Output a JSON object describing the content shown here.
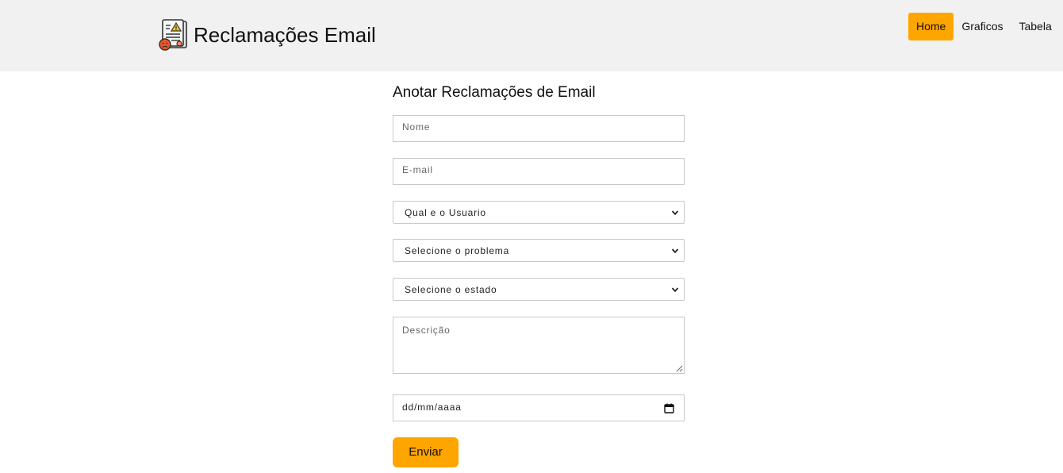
{
  "header": {
    "logo_icon": "complaint-document-icon",
    "title": "Reclamações Email",
    "nav": [
      {
        "label": "Home",
        "active": true
      },
      {
        "label": "Graficos",
        "active": false
      },
      {
        "label": "Tabela",
        "active": false
      }
    ]
  },
  "form": {
    "title": "Anotar Reclamações de Email",
    "nome_placeholder": "Nome",
    "email_placeholder": "E-mail",
    "usuario_select": "Qual e o Usuario",
    "problema_select": "Selecione o problema",
    "estado_select": "Selecione o estado",
    "descricao_placeholder": "Descrição",
    "date_value": "dd/mm/aaaa",
    "submit_label": "Enviar"
  },
  "colors": {
    "accent": "#ffa500",
    "header_bg": "#f1f1f1",
    "border": "#c8c8c8"
  }
}
